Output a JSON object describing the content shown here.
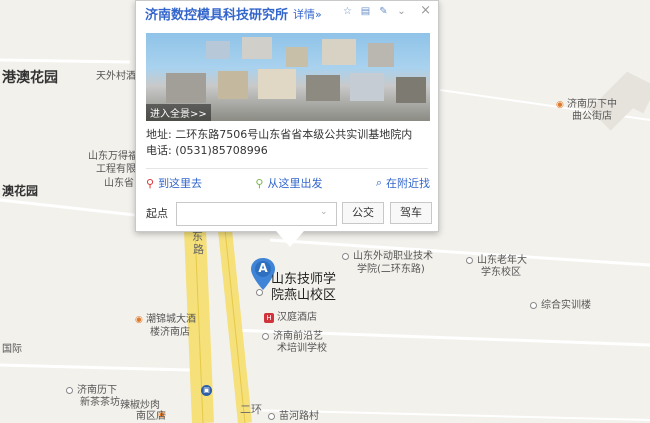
{
  "map": {
    "labels": {
      "gangao": "港澳花园",
      "aomen": "澳花园",
      "tianwai": "天外村酒",
      "wanshi": "山东万得福",
      "gongcheng": "工程有限",
      "shandong_e": "山东省",
      "lixia_rest": "济南历下中",
      "gongtian": "曲公街店",
      "zhiye": "山东外动职业技术",
      "xueyuan": "学院(二环东路)",
      "laonian": "山东老年大",
      "xueschool": "学东校区",
      "zonghe": "综合实训楼",
      "hengwei": "潮锦城大酒",
      "hengwei2": "楼济南店",
      "hanting": "汉庭酒店",
      "jiqian": "济南前沿艺",
      "jiqian2": "术培训学校",
      "guoji": "国际",
      "lixia_xia": "济南历下",
      "xiangcha": "新茶茶坊",
      "yanshan": "辣椒炒肉",
      "yanshan2": "南区店",
      "wanhe": "苗河路村",
      "road_dong": "东",
      "road_lu": "路",
      "road_er": "二环",
      "main_poi_line1": "山东技师学",
      "main_poi_line2": "院燕山校区",
      "marker_letter": "A"
    }
  },
  "popup": {
    "title": "济南数控模具科技研究所",
    "detail_link": "详情»",
    "close": "×",
    "panorama_enter": "进入全景>>",
    "address_label": "地址:",
    "address_value": "二环东路7506号山东省省本级公共实训基地院内",
    "phone_label": "电话:",
    "phone_value": "(0531)85708996",
    "actions": {
      "to_here": "到这里去",
      "from_here": "从这里出发",
      "nearby": "在附近找"
    },
    "start_label": "起点",
    "start_value": "",
    "bus_button": "公交",
    "drive_button": "驾车"
  }
}
